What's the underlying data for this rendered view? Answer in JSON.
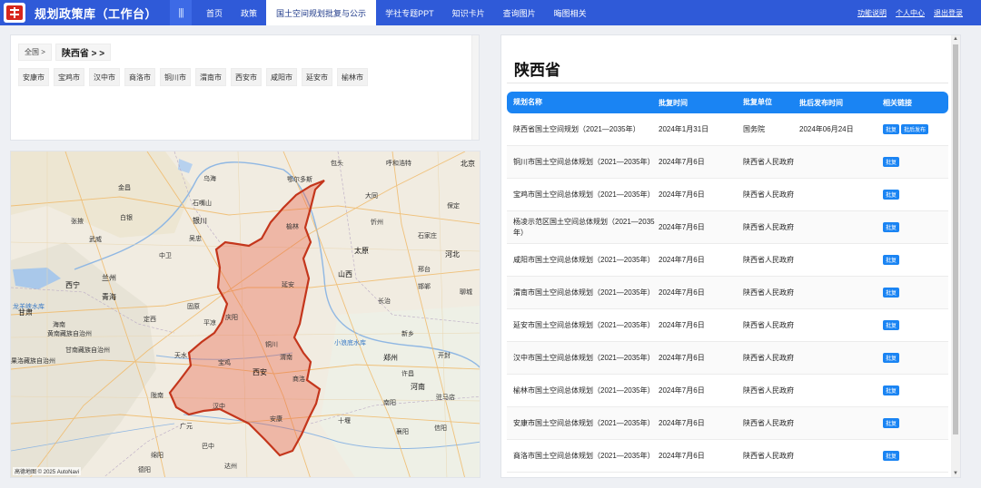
{
  "header": {
    "app_title": "规划政策库（工作台）",
    "menu_icon": "|||",
    "nav": [
      "首页",
      "政策",
      "国土空间规划批复与公示",
      "学社专题PPT",
      "知识卡片",
      "查询图片",
      "晦图相关"
    ],
    "active_nav": 2,
    "links": [
      "功能说明",
      "个人中心",
      "退出登录"
    ]
  },
  "filter": {
    "breadcrumb_root": "全国 >",
    "breadcrumb_current": "陕西省 > >",
    "cities": [
      "安康市",
      "宝鸡市",
      "汉中市",
      "商洛市",
      "铜川市",
      "渭南市",
      "西安市",
      "咸阳市",
      "延安市",
      "榆林市"
    ]
  },
  "map": {
    "highlight_color": "#e8553a",
    "labels": {
      "wuhai": "乌海",
      "baotou": "包头",
      "huhehaote": "呼和浩特",
      "eerduosi": "鄂尔多斯",
      "datong": "大同",
      "beijing": "北京",
      "jinchang": "金昌",
      "shizuishan": "石嘴山",
      "yinchuan": "银川",
      "wuwei": "武威",
      "wuzhong": "吴忠",
      "shuozhou": "朔州",
      "xinzhou": "忻州",
      "baoding": "保定",
      "yulin": "榆林",
      "shijiazhuang": "石家庄",
      "taiyuan": "太原",
      "zhongwei": "中卫",
      "lanzhou": "兰州",
      "xining": "西宁",
      "yanan": "延安",
      "xingtai": "邢台",
      "handan": "邯郸",
      "liaocheng": "聊城",
      "guyuan": "固原",
      "changzhi": "长治",
      "qingyang": "庆阳",
      "pingliang": "平凉",
      "dingxi": "定西",
      "tianshui": "天水",
      "xinxiang": "新乡",
      "tongchuan": "铜川",
      "zhengzhou": "郑州",
      "kaifeng": "开封",
      "xian": "西安",
      "baoji": "宝鸡",
      "weinan": "渭南",
      "xuchang": "许昌",
      "shangluo": "商洛",
      "nanyang": "南阳",
      "zhumadian": "驻马店",
      "hanzhong": "汉中",
      "ankang": "安康",
      "shiyan": "十堰",
      "xiangyang": "襄阳",
      "guangyuan": "广元",
      "bazhong": "巴中",
      "dazhou": "达州",
      "mianyang": "绵阳",
      "deyang": "德阳",
      "xinyang": "信阳",
      "gansu": "甘肃",
      "qinghai": "青海",
      "longnan": "陇南",
      "hebei": "河北",
      "shanxi": "山西",
      "henan": "河南",
      "xiaolangdi": "小浪底水库",
      "longyangxia": "龙羊峡水库",
      "nanyang2": "南阳",
      "baiyin": "白银",
      "zhangye": "张掖",
      "hainan": "海南",
      "huangnan": "黄南藏族自治州",
      "gannan": "甘南藏族自治州",
      "guoluo": "果洛藏族自治州"
    },
    "attribution": "高德地图 © 2025 AutoNavi"
  },
  "main": {
    "province_title": "陕西省",
    "columns": [
      "规划名称",
      "批复时间",
      "批复单位",
      "批后发布时间",
      "相关链接"
    ],
    "rows": [
      {
        "name": "陕西省国土空间规划（2021—2035年）",
        "date": "2024年1月31日",
        "unit": "国务院",
        "publish": "2024年06月24日",
        "tags": [
          "批复",
          "批后发布"
        ]
      },
      {
        "name": "铜川市国土空间总体规划（2021—2035年）",
        "date": "2024年7月6日",
        "unit": "陕西省人民政府",
        "publish": "",
        "tags": [
          "批复"
        ]
      },
      {
        "name": "宝鸡市国土空间总体规划（2021—2035年）",
        "date": "2024年7月6日",
        "unit": "陕西省人民政府",
        "publish": "",
        "tags": [
          "批复"
        ]
      },
      {
        "name": "杨凌示范区国土空间总体规划（2021—2035年）",
        "date": "2024年7月6日",
        "unit": "陕西省人民政府",
        "publish": "",
        "tags": [
          "批复"
        ]
      },
      {
        "name": "咸阳市国土空间总体规划（2021—2035年）",
        "date": "2024年7月6日",
        "unit": "陕西省人民政府",
        "publish": "",
        "tags": [
          "批复"
        ]
      },
      {
        "name": "渭南市国土空间总体规划（2021—2035年）",
        "date": "2024年7月6日",
        "unit": "陕西省人民政府",
        "publish": "",
        "tags": [
          "批复"
        ]
      },
      {
        "name": "延安市国土空间总体规划（2021—2035年）",
        "date": "2024年7月6日",
        "unit": "陕西省人民政府",
        "publish": "",
        "tags": [
          "批复"
        ]
      },
      {
        "name": "汉中市国土空间总体规划（2021—2035年）",
        "date": "2024年7月6日",
        "unit": "陕西省人民政府",
        "publish": "",
        "tags": [
          "批复"
        ]
      },
      {
        "name": "榆林市国土空间总体规划（2021—2035年）",
        "date": "2024年7月6日",
        "unit": "陕西省人民政府",
        "publish": "",
        "tags": [
          "批复"
        ]
      },
      {
        "name": "安康市国土空间总体规划（2021—2035年）",
        "date": "2024年7月6日",
        "unit": "陕西省人民政府",
        "publish": "",
        "tags": [
          "批复"
        ]
      },
      {
        "name": "商洛市国土空间总体规划（2021—2035年）",
        "date": "2024年7月6日",
        "unit": "陕西省人民政府",
        "publish": "",
        "tags": [
          "批复"
        ]
      }
    ]
  }
}
